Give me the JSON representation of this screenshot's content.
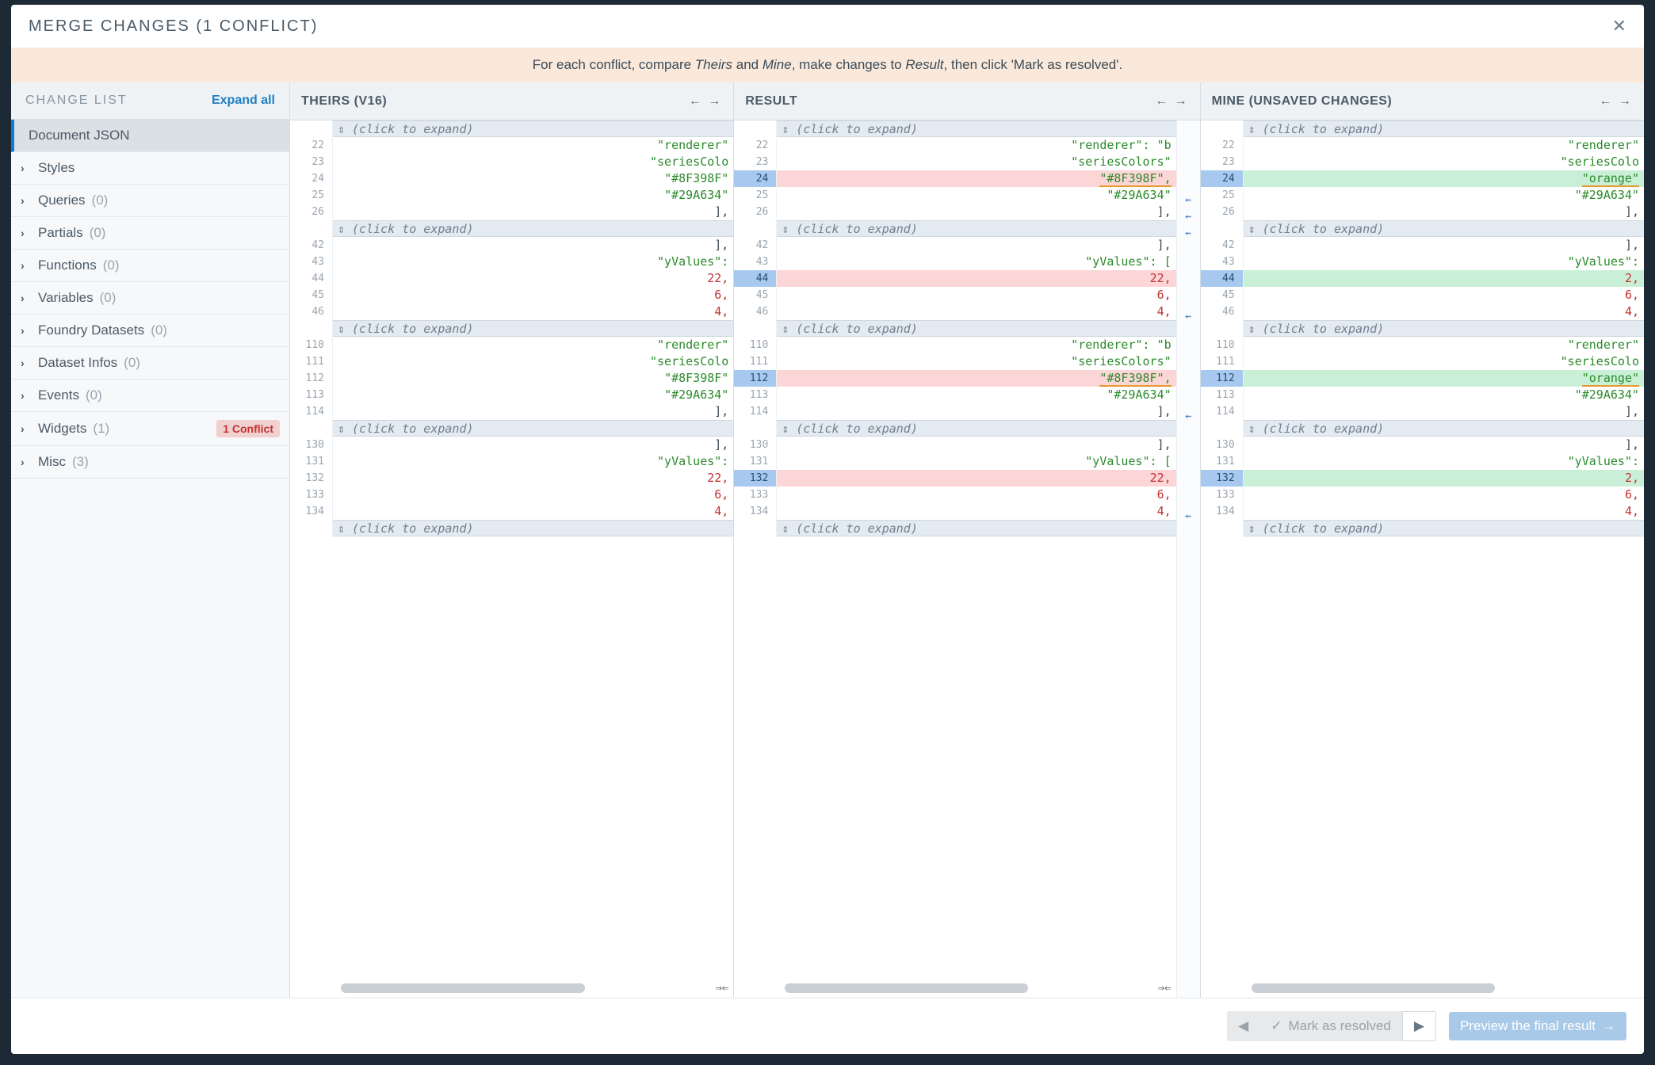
{
  "dialog": {
    "title": "MERGE CHANGES (1 CONFLICT)",
    "banner_prefix": "For each conflict, compare ",
    "banner_theirs": "Theirs",
    "banner_and": " and ",
    "banner_mine": "Mine",
    "banner_mid": ", make changes to ",
    "banner_result": "Result",
    "banner_suffix": ", then click 'Mark as resolved'."
  },
  "sidebar": {
    "title": "CHANGE LIST",
    "expand_all": "Expand all",
    "items": [
      {
        "label": "Document JSON",
        "count": "",
        "selected": true
      },
      {
        "label": "Styles",
        "count": ""
      },
      {
        "label": "Queries",
        "count": "(0)"
      },
      {
        "label": "Partials",
        "count": "(0)"
      },
      {
        "label": "Functions",
        "count": "(0)"
      },
      {
        "label": "Variables",
        "count": "(0)"
      },
      {
        "label": "Foundry Datasets",
        "count": "(0)"
      },
      {
        "label": "Dataset Infos",
        "count": "(0)"
      },
      {
        "label": "Events",
        "count": "(0)"
      },
      {
        "label": "Widgets",
        "count": "(1)",
        "badge": "1 Conflict"
      },
      {
        "label": "Misc",
        "count": "(3)"
      }
    ]
  },
  "panes": {
    "theirs_title": "THEIRS (V16)",
    "result_title": "RESULT",
    "mine_title": "MINE (UNSAVED CHANGES)",
    "fold_label": "(click to expand)"
  },
  "code": {
    "blocks": [
      {
        "fold_before": true,
        "lines": [
          {
            "n": 22,
            "theirs_txt": "\"renderer\"",
            "result_txt": "\"renderer\": \"b",
            "mine_txt": "\"renderer\""
          },
          {
            "n": 23,
            "theirs_txt": "\"seriesColo",
            "result_txt": "\"seriesColors\"",
            "mine_txt": "\"seriesColo"
          },
          {
            "n": 24,
            "theirs_txt": "\"#8F398F\"",
            "result_txt": "\"#8F398F\",",
            "mine_txt": "\"orange\"",
            "conflict": true
          },
          {
            "n": 25,
            "theirs_txt": "\"#29A634\"",
            "result_txt": "\"#29A634\"",
            "mine_txt": "\"#29A634\""
          },
          {
            "n": 26,
            "theirs_txt": "],",
            "result_txt": "],",
            "mine_txt": "],"
          }
        ],
        "fold_after": true
      },
      {
        "lines": [
          {
            "n": 42,
            "theirs_txt": "],",
            "result_txt": "],",
            "mine_txt": "],"
          },
          {
            "n": 43,
            "theirs_txt": "\"yValues\":",
            "result_txt": "\"yValues\": [",
            "mine_txt": "\"yValues\":"
          },
          {
            "n": 44,
            "theirs_txt": "22,",
            "result_txt": "22,",
            "mine_txt": "2,",
            "conflict": true,
            "numeric": true
          },
          {
            "n": 45,
            "theirs_txt": "6,",
            "result_txt": "6,",
            "mine_txt": "6,",
            "numeric": true
          },
          {
            "n": 46,
            "theirs_txt": "4,",
            "result_txt": "4,",
            "mine_txt": "4,",
            "numeric": true
          }
        ],
        "fold_after": true
      },
      {
        "lines": [
          {
            "n": 110,
            "theirs_txt": "\"renderer\"",
            "result_txt": "\"renderer\": \"b",
            "mine_txt": "\"renderer\""
          },
          {
            "n": 111,
            "theirs_txt": "\"seriesColo",
            "result_txt": "\"seriesColors\"",
            "mine_txt": "\"seriesColo"
          },
          {
            "n": 112,
            "theirs_txt": "\"#8F398F\"",
            "result_txt": "\"#8F398F\",",
            "mine_txt": "\"orange\"",
            "conflict": true
          },
          {
            "n": 113,
            "theirs_txt": "\"#29A634\"",
            "result_txt": "\"#29A634\"",
            "mine_txt": "\"#29A634\""
          },
          {
            "n": 114,
            "theirs_txt": "],",
            "result_txt": "],",
            "mine_txt": "],"
          }
        ],
        "fold_after": true
      },
      {
        "lines": [
          {
            "n": 130,
            "theirs_txt": "],",
            "result_txt": "],",
            "mine_txt": "],"
          },
          {
            "n": 131,
            "theirs_txt": "\"yValues\":",
            "result_txt": "\"yValues\": [",
            "mine_txt": "\"yValues\":"
          },
          {
            "n": 132,
            "theirs_txt": "22,",
            "result_txt": "22,",
            "mine_txt": "2,",
            "conflict": true,
            "numeric": true
          },
          {
            "n": 133,
            "theirs_txt": "6,",
            "result_txt": "6,",
            "mine_txt": "6,",
            "numeric": true
          },
          {
            "n": 134,
            "theirs_txt": "4,",
            "result_txt": "4,",
            "mine_txt": "4,",
            "numeric": true
          }
        ],
        "fold_after": true
      }
    ]
  },
  "footer": {
    "mark_resolved": "Mark as resolved",
    "preview": "Preview the final result"
  }
}
